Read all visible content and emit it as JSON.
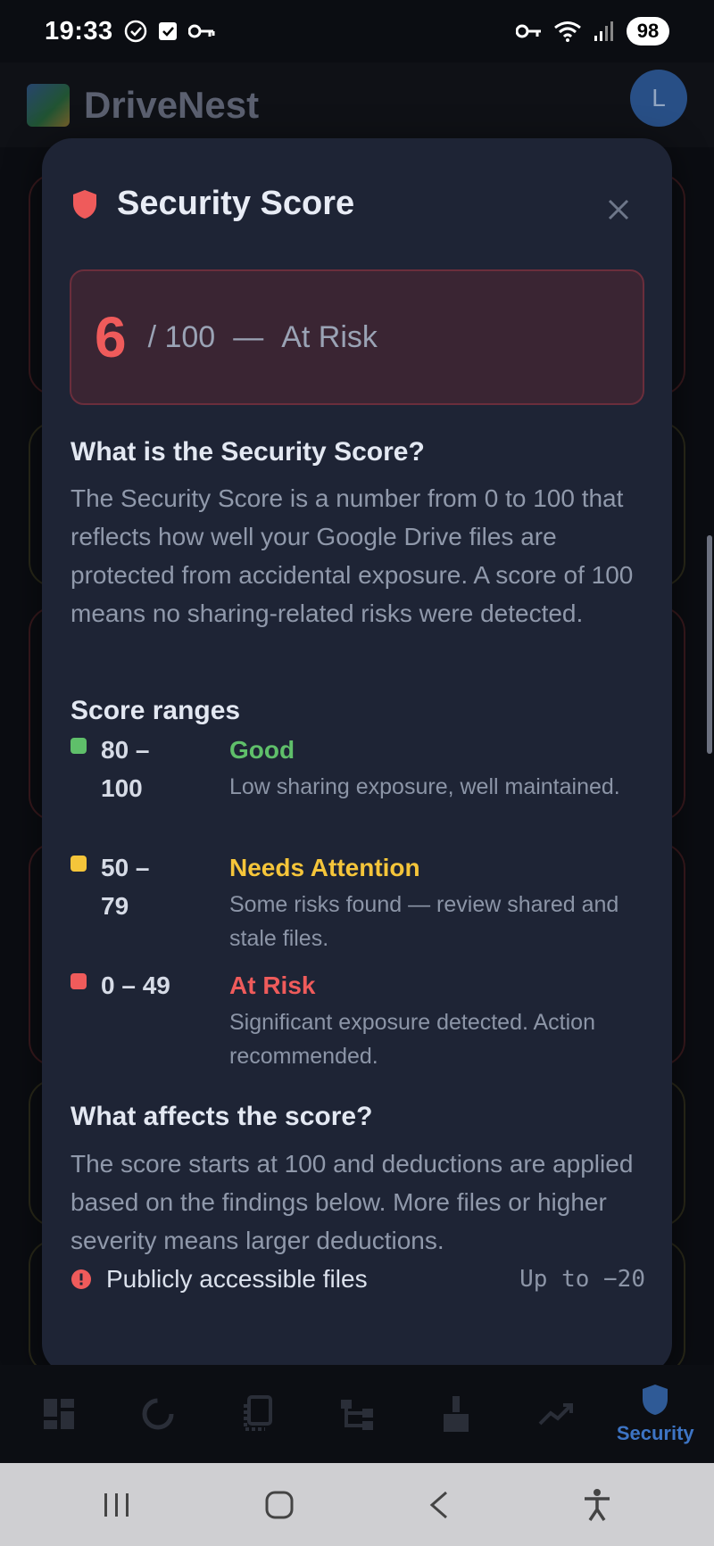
{
  "status_bar": {
    "time": "19:33",
    "battery": "98"
  },
  "app_bar": {
    "title": "DriveNest",
    "avatar_initial": "L"
  },
  "dialog": {
    "title": "Security Score",
    "score": {
      "value": "6",
      "max": "/ 100",
      "separator": "—",
      "rating": "At Risk"
    },
    "what_is": {
      "title": "What is the Security Score?",
      "body": "The Security Score is a number from 0 to 100 that reflects how well your Google Drive files are protected from accidental exposure. A score of 100 means no sharing-related risks were detected."
    },
    "ranges": {
      "title": "Score ranges",
      "items": [
        {
          "range": "80 – 100",
          "name": "Good",
          "description": "Low sharing exposure, well maintained.",
          "color": "#5fbf6a"
        },
        {
          "range": "50 – 79",
          "name": "Needs Attention",
          "description": "Some risks found — review shared and stale files.",
          "color": "#f5c53a"
        },
        {
          "range": "0 – 49",
          "name": "At Risk",
          "description": "Significant exposure detected. Action recommended.",
          "color": "#ef5b5b"
        }
      ]
    },
    "affects": {
      "title": "What affects the score?",
      "body": "The score starts at 100 and deductions are applied based on the findings below. More files or higher severity means larger deductions."
    },
    "factors": [
      {
        "label": "Publicly accessible files",
        "value": "Up to −20",
        "icon": "alert-circle-icon"
      }
    ]
  },
  "bottom_nav": {
    "items": [
      {
        "icon": "dashboard-icon"
      },
      {
        "icon": "sync-icon"
      },
      {
        "icon": "files-icon"
      },
      {
        "icon": "tree-icon"
      },
      {
        "icon": "broom-icon"
      },
      {
        "icon": "trend-icon"
      },
      {
        "icon": "shield-icon",
        "label": "Security",
        "active": true
      }
    ]
  }
}
